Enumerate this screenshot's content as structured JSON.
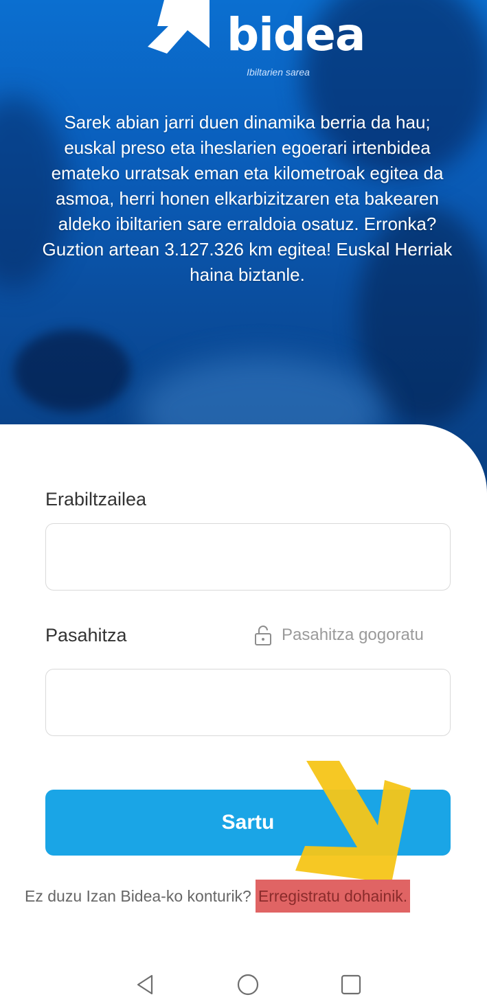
{
  "hero": {
    "logo_text": "bidea",
    "logo_tagline": "Ibiltarien sarea",
    "description": "Sarek abian jarri duen dinamika berria da hau; euskal preso eta iheslarien egoerari irtenbidea emateko urratsak eman eta kilometroak egitea da asmoa, herri honen elkarbizitzaren eta bakearen aldeko ibiltarien sare erraldoia osatuz. Erronka? Guztion artean 3.127.326 km egitea! Euskal Herriak haina biztanle."
  },
  "login": {
    "username_label": "Erabiltzailea",
    "username_value": "",
    "password_label": "Pasahitza",
    "password_value": "",
    "remember_label": "Pasahitza gogoratu",
    "submit_label": "Sartu",
    "signup_prompt": "Ez duzu Izan Bidea-ko konturik?",
    "signup_link": "Erregistratu dohainik."
  },
  "icons": {
    "logo": "arrow-logo-icon",
    "remember": "lock-open-icon",
    "overlay": "yellow-arrow-icon",
    "nav_back": "back-triangle-icon",
    "nav_home": "home-circle-icon",
    "nav_recents": "recents-square-icon"
  },
  "colors": {
    "hero_blue": "#0a5fbd",
    "button_blue": "#1aa5e6",
    "highlight_red": "#e06464",
    "arrow_yellow": "#f5c518"
  }
}
